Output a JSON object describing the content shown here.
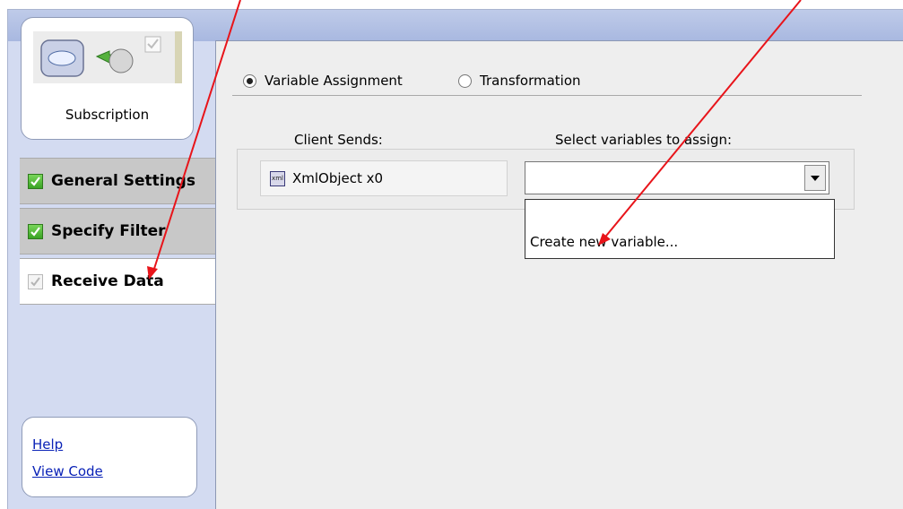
{
  "sidebar": {
    "subscription_label": "Subscription",
    "steps": [
      {
        "label": "General Settings",
        "status": "complete"
      },
      {
        "label": "Specify Filter",
        "status": "complete"
      },
      {
        "label": "Receive Data",
        "status": "current"
      }
    ],
    "links": [
      {
        "label": "Help"
      },
      {
        "label": "View Code"
      }
    ]
  },
  "main": {
    "mode_options": [
      {
        "label": "Variable Assignment",
        "selected": true
      },
      {
        "label": "Transformation",
        "selected": false
      }
    ],
    "columns": {
      "client_sends": "Client Sends:",
      "select_variables": "Select variables to assign:"
    },
    "client_item": "XmlObject x0",
    "variable_combo_value": "",
    "dropdown_options": [
      "",
      "Create new variable..."
    ]
  },
  "colors": {
    "annotation_arrow": "#e8141a",
    "panel_bg": "#d3dbf1",
    "check_green": "#3aa324",
    "link": "#0a22b7"
  }
}
